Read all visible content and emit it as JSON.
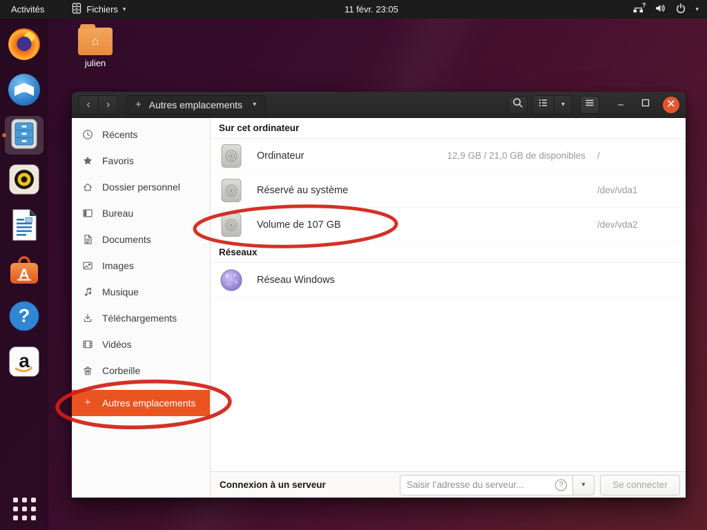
{
  "colors": {
    "accent": "#e95420",
    "close_button": "#e8552b",
    "annotation_red": "#d01f14",
    "selection_orange": "#e95420"
  },
  "topbar": {
    "activities_label": "Activités",
    "app_menu_label": "Fichiers",
    "clock": "11 févr. 23:05",
    "caret_glyph": "▾",
    "network_unknown_glyph": "?"
  },
  "desktop": {
    "folder_label": "julien",
    "home_glyph": "⌂"
  },
  "dock": {
    "items": [
      "firefox",
      "thunderbird",
      "files",
      "rhythmbox",
      "libreoffice-writer",
      "ubuntu-software",
      "help",
      "amazon"
    ],
    "active_item": "files",
    "software_letter": "A",
    "help_glyph": "?",
    "amazon_letter": "a"
  },
  "window": {
    "titlebar": {
      "back_glyph": "‹",
      "forward_glyph": "›",
      "add_glyph": "+",
      "location_label": "Autres emplacements",
      "caret_glyph": "▾",
      "minimize_glyph": "–"
    },
    "sidebar": {
      "add_glyph": "+",
      "items": [
        {
          "label": "Récents"
        },
        {
          "label": "Favoris"
        },
        {
          "label": "Dossier personnel"
        },
        {
          "label": "Bureau"
        },
        {
          "label": "Documents"
        },
        {
          "label": "Images"
        },
        {
          "label": "Musique"
        },
        {
          "label": "Téléchargements"
        },
        {
          "label": "Vidéos"
        },
        {
          "label": "Corbeille"
        },
        {
          "label": "Autres emplacements",
          "selected": true
        }
      ]
    },
    "content": {
      "sections": [
        {
          "title": "Sur cet ordinateur",
          "rows": [
            {
              "name": "Ordinateur",
              "free": "12,9 GB / 21,0 GB de disponibles",
              "path": "/"
            },
            {
              "name": "Réservé au système",
              "free": "",
              "path": "/dev/vda1"
            },
            {
              "name": "Volume de 107 GB",
              "free": "",
              "path": "/dev/vda2"
            }
          ]
        },
        {
          "title": "Réseaux",
          "rows": [
            {
              "name": "Réseau Windows",
              "free": "",
              "path": ""
            }
          ]
        }
      ]
    },
    "bottombar": {
      "label": "Connexion à un serveur",
      "input_placeholder": "Saisir l’adresse du serveur...",
      "help_glyph": "?",
      "caret_glyph": "▾",
      "connect_label": "Se connecter"
    }
  },
  "annotations": {
    "ellipses": [
      {
        "target": "volume-107-gb-row"
      },
      {
        "target": "sidebar-autres-emplacements"
      }
    ]
  }
}
